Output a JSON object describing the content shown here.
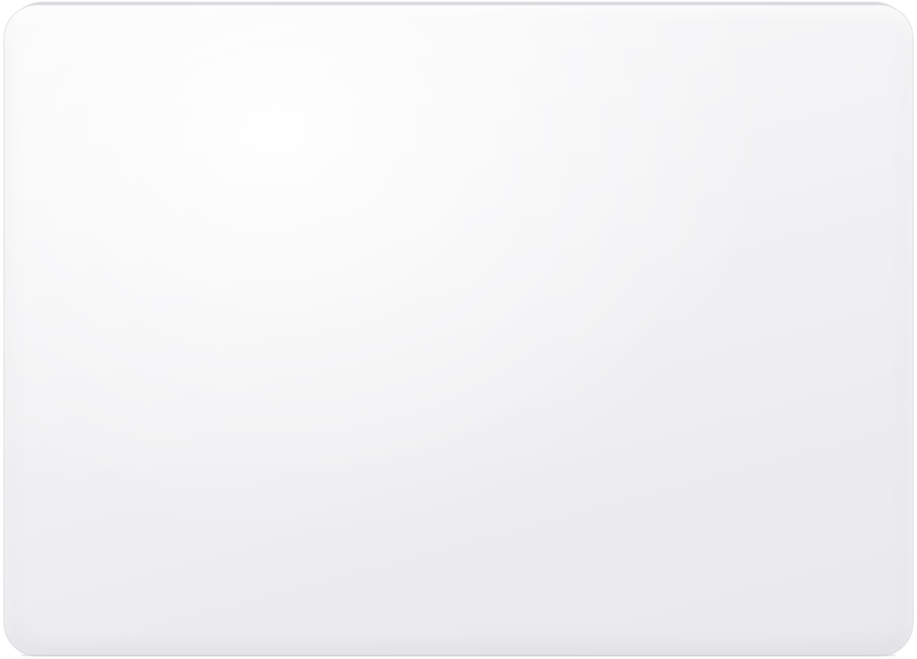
{
  "image": {
    "subject": "trackpad",
    "colors": {
      "background": "#ffffff",
      "surface": "#f1f1f3",
      "edge": "#cfd0d6"
    }
  }
}
